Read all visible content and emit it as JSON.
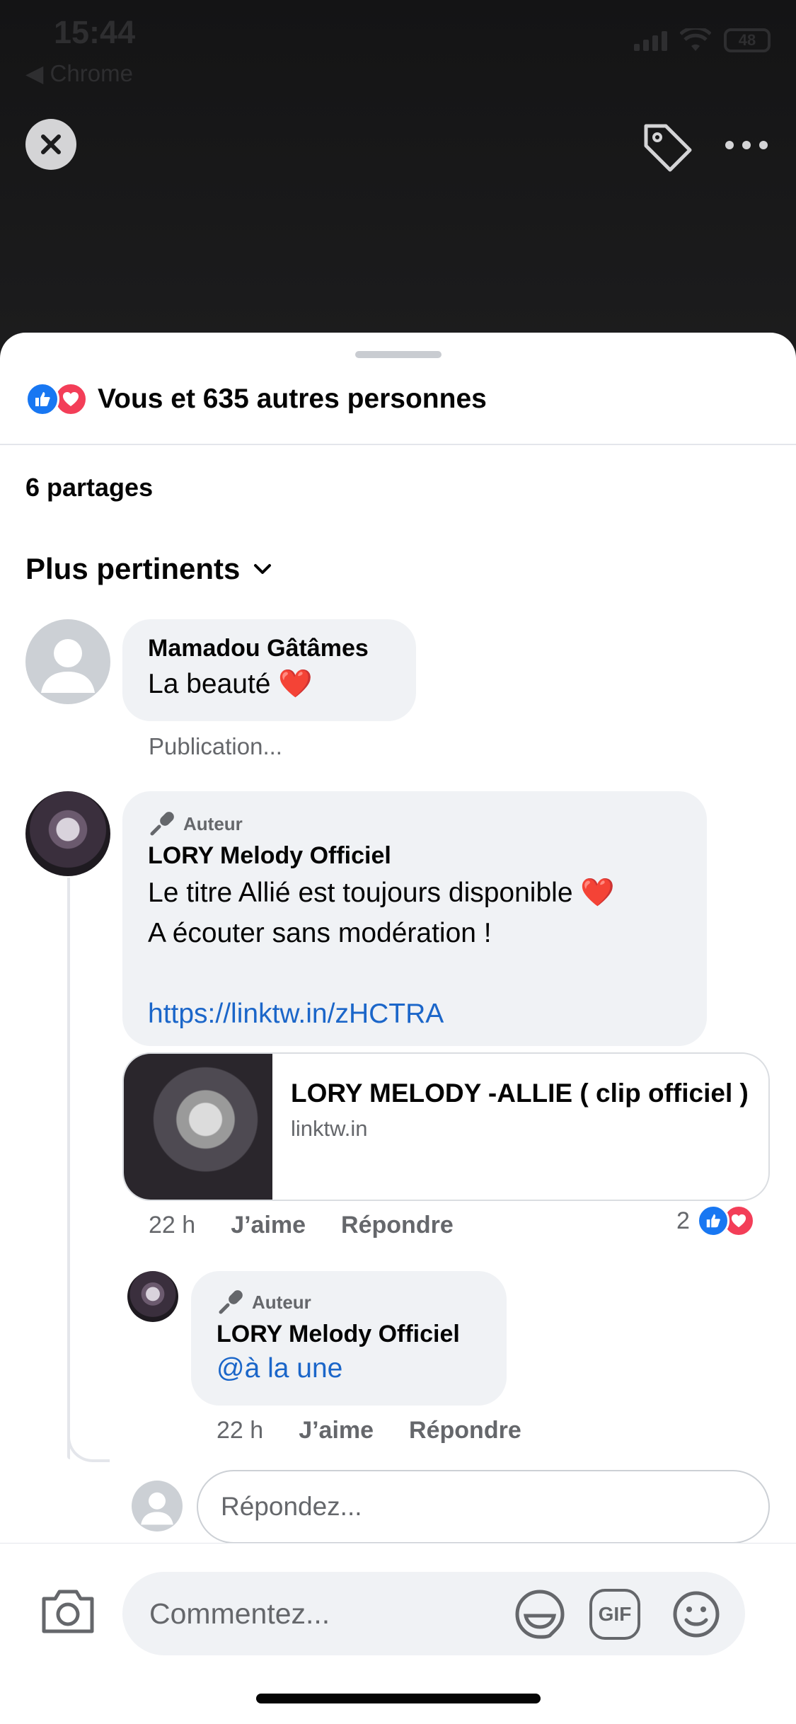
{
  "status_bar": {
    "time": "15:44",
    "back_app": "◀ Chrome",
    "battery": "48"
  },
  "sheet": {
    "reactions_summary": "Vous et 635 autres personnes",
    "shares": "6 partages",
    "sort_label": "Plus pertinents"
  },
  "comments": [
    {
      "name": "Mamadou Gâtâmes",
      "text": "La beauté ❤️",
      "sub_link": "Publication..."
    },
    {
      "author_badge": "Auteur",
      "name": "LORY Melody Officiel",
      "text_line1": "Le titre Allié est toujours disponible ❤️",
      "text_line2": "A écouter sans modération !",
      "url": "https://linktw.in/zHCTRA",
      "link_title": "LORY MELODY -ALLIE ( clip officiel )",
      "link_domain": "linktw.in",
      "time": "22 h",
      "like": "J’aime",
      "reply": "Répondre",
      "reaction_count": "2"
    }
  ],
  "reply": {
    "author_badge": "Auteur",
    "name": "LORY Melody Officiel",
    "mention": "@à la une",
    "time": "22 h",
    "like": "J’aime",
    "reply": "Répondre"
  },
  "reply_input": {
    "placeholder": "Répondez..."
  },
  "composer": {
    "placeholder": "Commentez...",
    "gif_label": "GIF"
  },
  "icons": [
    "close-icon",
    "tag-icon",
    "more-icon",
    "like-icon",
    "love-icon",
    "chevron-down-icon",
    "microphone-icon",
    "camera-icon",
    "sticker-icon",
    "gif-icon",
    "emoji-icon"
  ],
  "colors": {
    "accent": "#1877f2",
    "love": "#f33e58",
    "link": "#1b66c9",
    "muted": "#65676b"
  }
}
